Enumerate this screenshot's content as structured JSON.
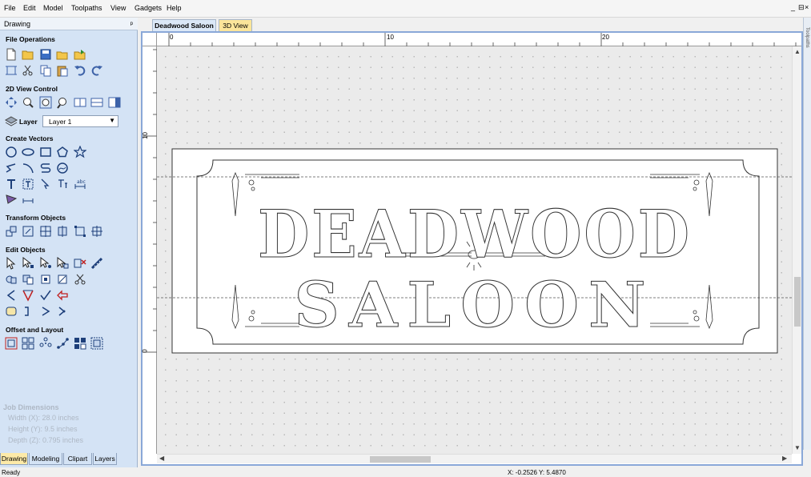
{
  "menu": [
    "File",
    "Edit",
    "Model",
    "Toolpaths",
    "View",
    "Gadgets",
    "Help"
  ],
  "window_controls": [
    "_",
    "⊟",
    "×"
  ],
  "panel": {
    "title": "Drawing",
    "pin": "ᵖ",
    "sections": {
      "file_operations": "File Operations",
      "view_control": "2D View Control",
      "create_vectors": "Create Vectors",
      "transform_objects": "Transform Objects",
      "edit_objects": "Edit Objects",
      "offset_layout": "Offset and Layout"
    },
    "layer_label": "Layer",
    "layer_value": "Layer 1",
    "job_dimensions": {
      "title": "Job Dimensions",
      "width": "Width  (X): 28.0 inches",
      "height": "Height (Y): 9.5 inches",
      "depth": "Depth  (Z): 0.795 inches"
    },
    "bottom_tabs": [
      "Drawing",
      "Modeling",
      "Clipart",
      "Layers"
    ]
  },
  "doc_tabs": [
    "Deadwood Saloon",
    "3D View"
  ],
  "right_strip_label": "Toolpaths",
  "ruler": {
    "h": [
      "0",
      "10",
      "20"
    ],
    "v": [
      "10",
      "0"
    ]
  },
  "design": {
    "line1": "DEADWOOD",
    "line2": "SALOON"
  },
  "status": {
    "text": "Ready",
    "coords": "X: -0.2526 Y:  5.4870"
  },
  "colors": {
    "panel_bg": "#d4e3f5",
    "active_tab": "#fdeaa8",
    "view_border": "#8aa8d8"
  }
}
